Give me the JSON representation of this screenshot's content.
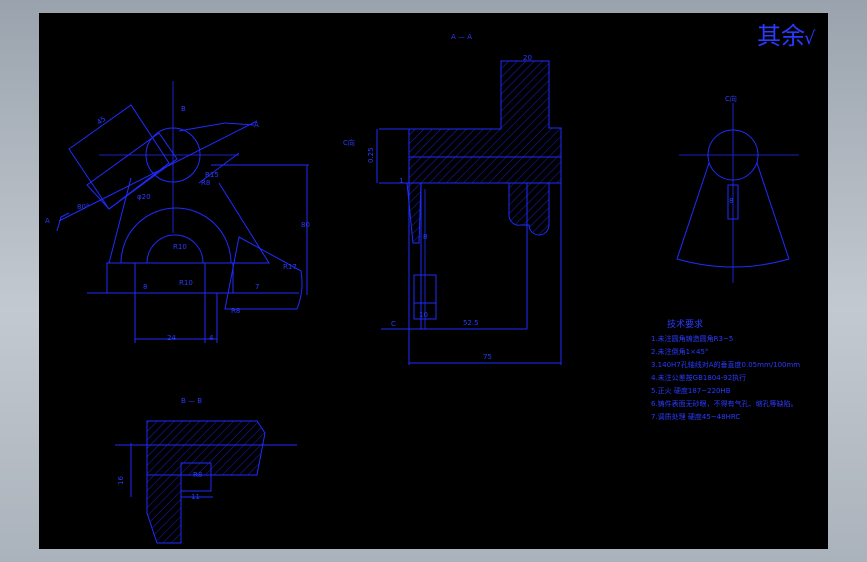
{
  "surface_finish": {
    "text": "其余",
    "mark": "√"
  },
  "section_labels": {
    "aa": "A — A",
    "bb": "B — B",
    "b_top": "B",
    "b_bottom": "B",
    "a_right": "A",
    "a_left": "A",
    "c_right": "C向"
  },
  "left_view": {
    "dims": [
      "45",
      "80",
      "R8",
      "R15",
      "φ20",
      "R17",
      "R10",
      "24",
      "4",
      "8",
      "7",
      "R10",
      "R8",
      "80°"
    ]
  },
  "aa_view": {
    "dims": [
      "20",
      "C向",
      "0.25",
      "8",
      "10",
      "52.5",
      "C",
      "75",
      "1"
    ]
  },
  "c_view": {
    "dims": [
      "8"
    ]
  },
  "bb_view": {
    "dims": [
      "16",
      "11",
      "R8"
    ]
  },
  "notes": {
    "title": "技术要求",
    "items": [
      "1.未注圆角铸造圆角R3~5",
      "2.未注倒角1×45°",
      "3.140H7孔轴线对A的垂直度0.05mm/100mm",
      "4.未注公差按GB1804-92执行",
      "5.正火 硬度187~220HB",
      "6.铸件表面无砂眼，不得有气孔、缩孔等缺陷。",
      "7.调质处理 硬度45~48HRC"
    ]
  }
}
